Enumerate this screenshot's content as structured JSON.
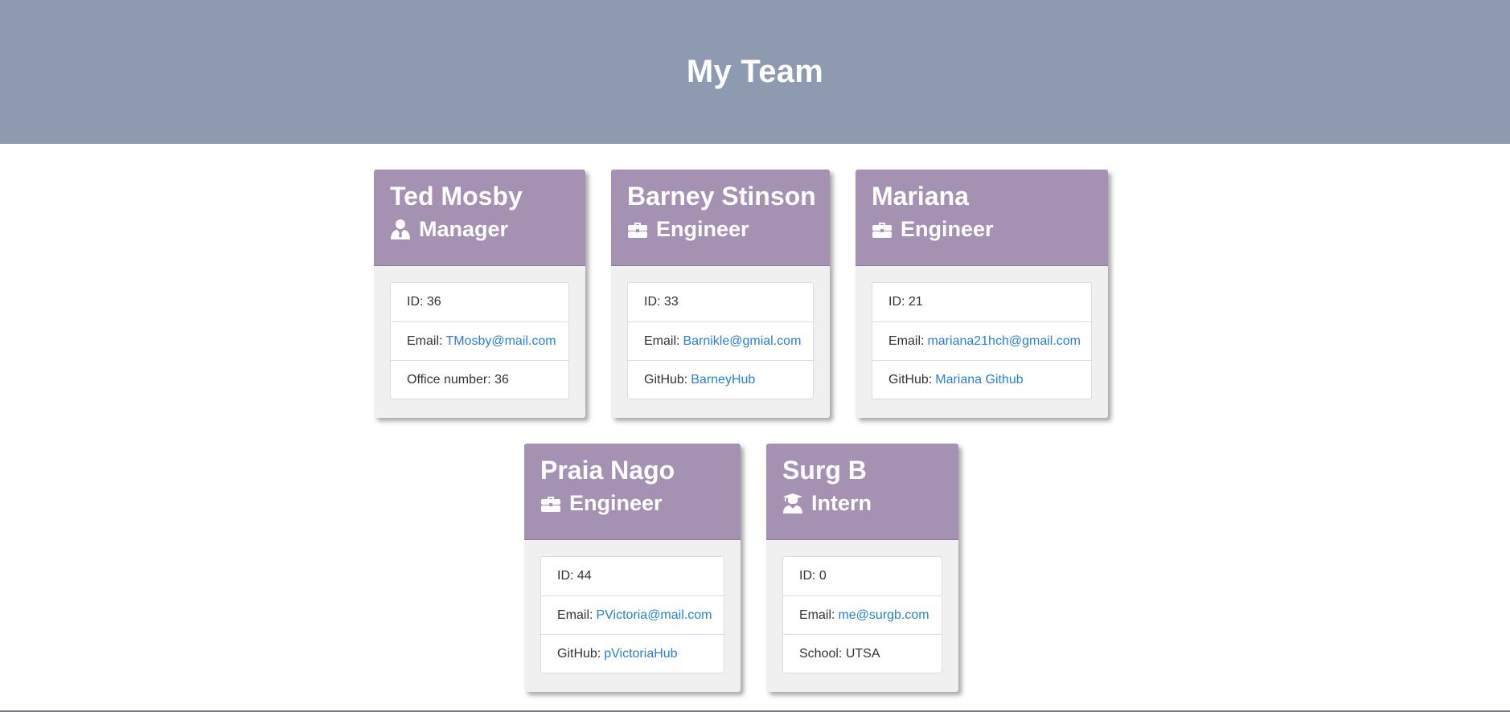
{
  "page": {
    "title": "My Team"
  },
  "colors": {
    "header_bg": "#8e9ab0",
    "card_header_bg": "#a592b3",
    "link": "#2a7fd4"
  },
  "cards": [
    {
      "name": "Ted Mosby",
      "role": "Manager",
      "role_icon": "user-tie-icon",
      "id_label": "ID: 36",
      "email_label": "Email:",
      "email": "TMosby@mail.com",
      "extra_label": "Office number: 36"
    },
    {
      "name": "Barney Stinson",
      "role": "Engineer",
      "role_icon": "briefcase-icon",
      "id_label": "ID: 33",
      "email_label": "Email:",
      "email": "Barnikle@gmial.com",
      "extra_label": "GitHub:",
      "extra_link": "BarneyHub"
    },
    {
      "name": "Mariana",
      "role": "Engineer",
      "role_icon": "briefcase-icon",
      "id_label": "ID: 21",
      "email_label": "Email:",
      "email": "mariana21hch@gmail.com",
      "extra_label": "GitHub:",
      "extra_link": "Mariana Github"
    },
    {
      "name": "Praia Nago",
      "role": "Engineer",
      "role_icon": "briefcase-icon",
      "id_label": "ID: 44",
      "email_label": "Email:",
      "email": "PVictoria@mail.com",
      "extra_label": "GitHub:",
      "extra_link": "pVictoriaHub"
    },
    {
      "name": "Surg B",
      "role": "Intern",
      "role_icon": "graduate-icon",
      "id_label": "ID: 0",
      "email_label": "Email:",
      "email": "me@surgb.com",
      "extra_label": "School: UTSA"
    }
  ]
}
